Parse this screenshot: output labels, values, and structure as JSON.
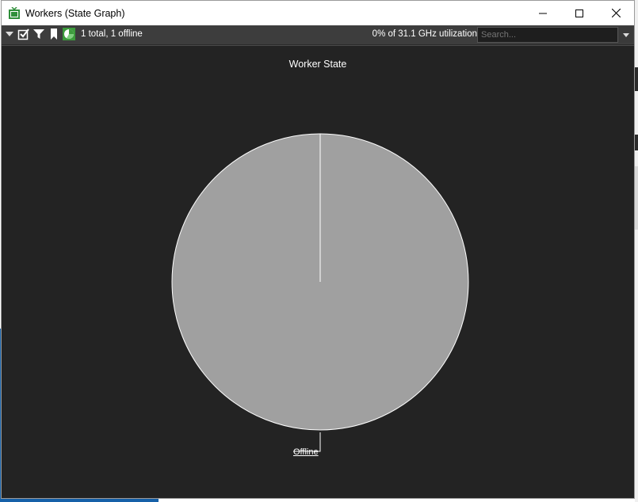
{
  "window": {
    "title": "Workers (State Graph)"
  },
  "toolbar": {
    "status": "1 total, 1 offline",
    "utilization": "0% of 31.1 GHz utilization",
    "search_placeholder": "Search...",
    "icons": [
      "dropdown-icon",
      "checkbox-icon",
      "filter-icon",
      "bookmark-icon",
      "pie-chart-icon"
    ]
  },
  "chart_data": {
    "type": "pie",
    "title": "Worker State",
    "categories": [
      "Offline"
    ],
    "values": [
      1
    ],
    "colors": [
      "#a0a0a0"
    ]
  },
  "colors": {
    "background": "#232323",
    "toolbar": "#3d3d3d",
    "slice": "#a0a0a0",
    "accent_green": "#3c9b3c"
  }
}
